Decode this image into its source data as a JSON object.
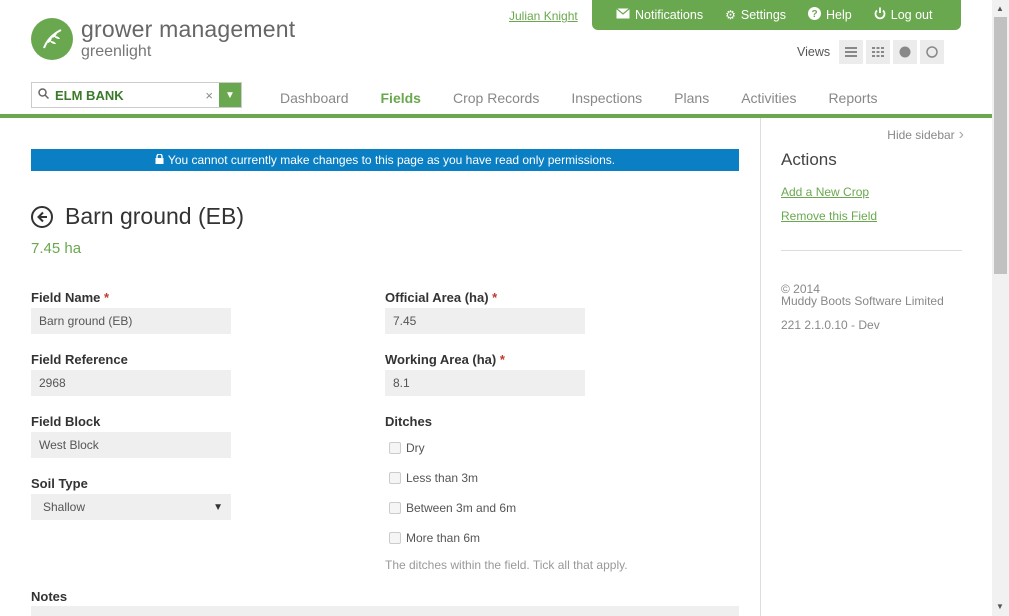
{
  "header": {
    "logo_main": "grower management",
    "logo_sub": "greenlight",
    "user": "Julian Knight",
    "topbar": {
      "notifications": "Notifications",
      "settings": "Settings",
      "help": "Help",
      "logout": "Log out"
    },
    "views_label": "Views"
  },
  "search": {
    "value": "ELM BANK",
    "clear": "×"
  },
  "nav": {
    "dashboard": "Dashboard",
    "fields": "Fields",
    "crop_records": "Crop Records",
    "inspections": "Inspections",
    "plans": "Plans",
    "activities": "Activities",
    "reports": "Reports"
  },
  "notice": "You cannot currently make changes to this page as you have read only permissions.",
  "page": {
    "title": "Barn ground (EB)",
    "area": "7.45 ha"
  },
  "form": {
    "field_name": {
      "label": "Field Name",
      "value": "Barn ground (EB)"
    },
    "field_reference": {
      "label": "Field Reference",
      "value": "2968"
    },
    "field_block": {
      "label": "Field Block",
      "value": "West Block"
    },
    "soil_type": {
      "label": "Soil Type",
      "value": "Shallow"
    },
    "official_area": {
      "label": "Official Area (ha)",
      "value": "7.45"
    },
    "working_area": {
      "label": "Working Area (ha)",
      "value": "8.1"
    },
    "ditches": {
      "label": "Ditches",
      "options": [
        "Dry",
        "Less than 3m",
        "Between 3m and 6m",
        "More than 6m"
      ],
      "hint": "The ditches within the field. Tick all that apply."
    },
    "notes": {
      "label": "Notes"
    },
    "required_mark": "*"
  },
  "sidebar": {
    "hide": "Hide sidebar",
    "actions_title": "Actions",
    "add_crop": "Add a New Crop",
    "remove_field": "Remove this Field",
    "copyright": "© 2014",
    "company": "Muddy Boots Software Limited",
    "version": "221 2.1.0.10 - Dev"
  },
  "colors": {
    "brand_green": "#6aa84f",
    "notice_blue": "#0a7fc4"
  }
}
